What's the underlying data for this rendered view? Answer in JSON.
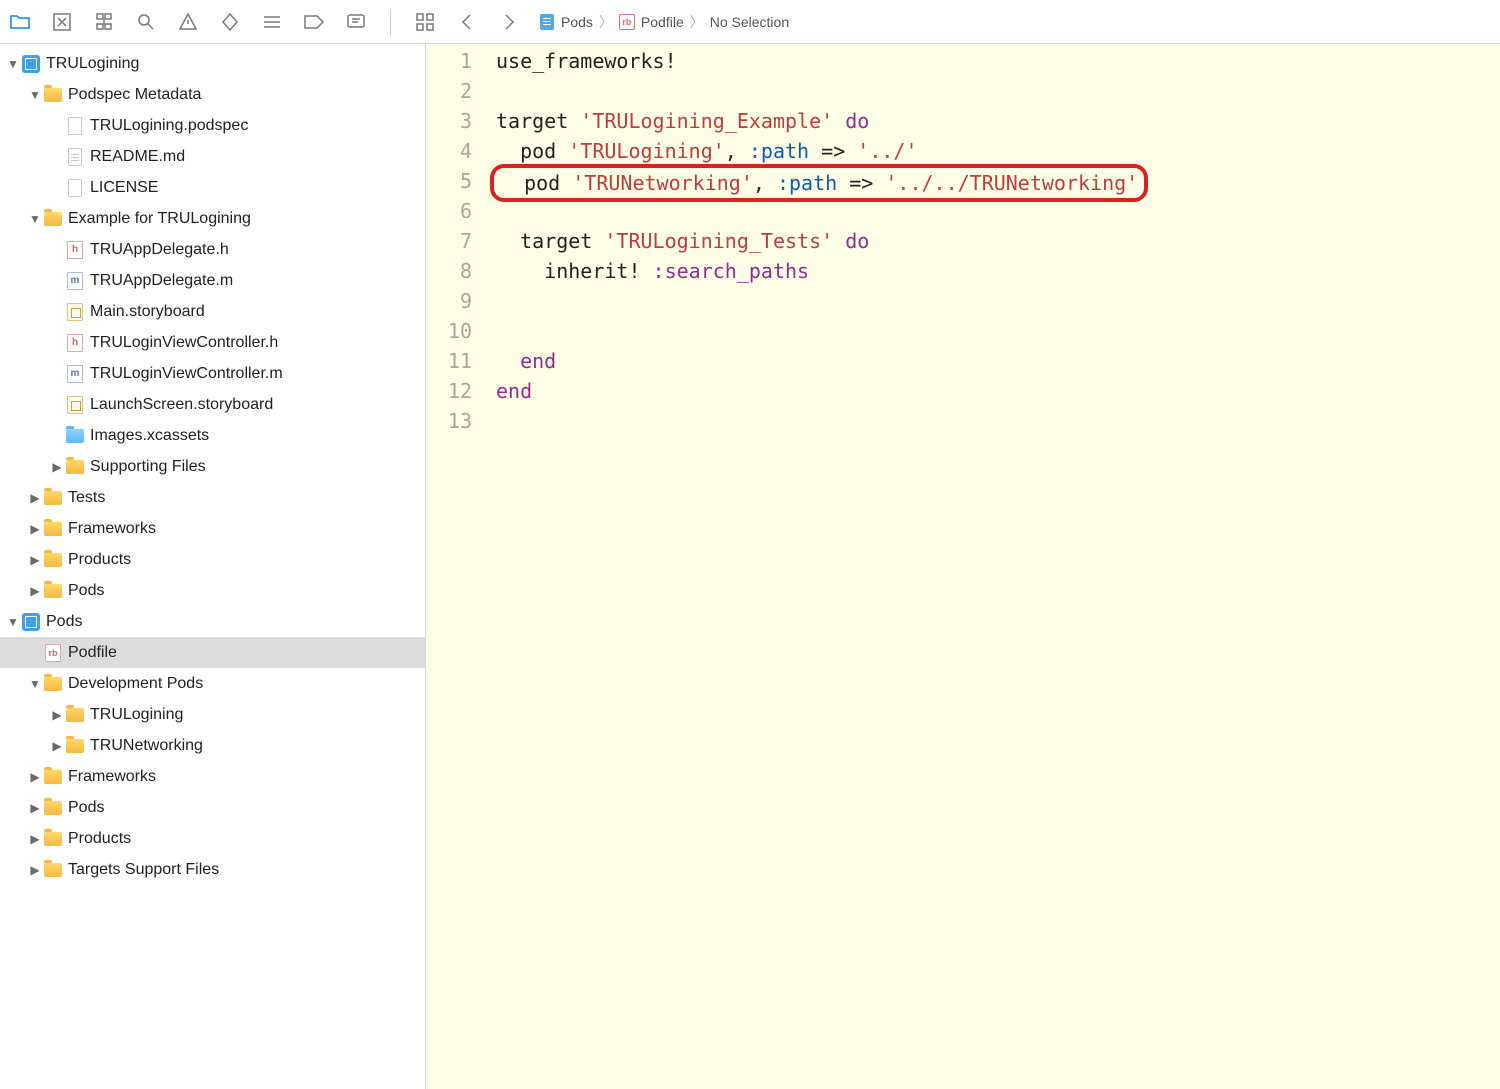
{
  "toolbar": {
    "icons": [
      "folder-icon",
      "schema-icon",
      "hierarchy-icon",
      "search-icon",
      "warning-icon",
      "diamond-icon",
      "list-icon",
      "tag-icon",
      "comment-icon"
    ]
  },
  "breadcrumb": {
    "items": [
      "Pods",
      "Podfile",
      "No Selection"
    ]
  },
  "tree": [
    {
      "label": "TRULogining",
      "depth": 0,
      "icon": "proj",
      "disc": "down"
    },
    {
      "label": "Podspec Metadata",
      "depth": 1,
      "icon": "folder",
      "disc": "down"
    },
    {
      "label": "TRULogining.podspec",
      "depth": 2,
      "icon": "plain",
      "disc": ""
    },
    {
      "label": "README.md",
      "depth": 2,
      "icon": "lines",
      "disc": ""
    },
    {
      "label": "LICENSE",
      "depth": 2,
      "icon": "plain",
      "disc": ""
    },
    {
      "label": "Example for TRULogining",
      "depth": 1,
      "icon": "folder",
      "disc": "down"
    },
    {
      "label": "TRUAppDelegate.h",
      "depth": 2,
      "icon": "h",
      "disc": ""
    },
    {
      "label": "TRUAppDelegate.m",
      "depth": 2,
      "icon": "m",
      "disc": ""
    },
    {
      "label": "Main.storyboard",
      "depth": 2,
      "icon": "story",
      "disc": ""
    },
    {
      "label": "TRULoginViewController.h",
      "depth": 2,
      "icon": "h",
      "disc": ""
    },
    {
      "label": "TRULoginViewController.m",
      "depth": 2,
      "icon": "m",
      "disc": ""
    },
    {
      "label": "LaunchScreen.storyboard",
      "depth": 2,
      "icon": "story",
      "disc": ""
    },
    {
      "label": "Images.xcassets",
      "depth": 2,
      "icon": "folderblue",
      "disc": ""
    },
    {
      "label": "Supporting Files",
      "depth": 2,
      "icon": "folder",
      "disc": "right"
    },
    {
      "label": "Tests",
      "depth": 1,
      "icon": "folder",
      "disc": "right"
    },
    {
      "label": "Frameworks",
      "depth": 1,
      "icon": "folder",
      "disc": "right"
    },
    {
      "label": "Products",
      "depth": 1,
      "icon": "folder",
      "disc": "right"
    },
    {
      "label": "Pods",
      "depth": 1,
      "icon": "folder",
      "disc": "right"
    },
    {
      "label": "Pods",
      "depth": 0,
      "icon": "proj",
      "disc": "down"
    },
    {
      "label": "Podfile",
      "depth": 1,
      "icon": "rb",
      "disc": "",
      "selected": true
    },
    {
      "label": "Development Pods",
      "depth": 1,
      "icon": "folder",
      "disc": "down"
    },
    {
      "label": "TRULogining",
      "depth": 2,
      "icon": "folder",
      "disc": "right"
    },
    {
      "label": "TRUNetworking",
      "depth": 2,
      "icon": "folder",
      "disc": "right"
    },
    {
      "label": "Frameworks",
      "depth": 1,
      "icon": "folder",
      "disc": "right"
    },
    {
      "label": "Pods",
      "depth": 1,
      "icon": "folder",
      "disc": "right"
    },
    {
      "label": "Products",
      "depth": 1,
      "icon": "folder",
      "disc": "right"
    },
    {
      "label": "Targets Support Files",
      "depth": 1,
      "icon": "folder",
      "disc": "right"
    }
  ],
  "code": {
    "lines": [
      [
        {
          "t": "use_frameworks!",
          "c": "txt"
        }
      ],
      [],
      [
        {
          "t": "target ",
          "c": "txt"
        },
        {
          "t": "'TRULogining_Example'",
          "c": "str"
        },
        {
          "t": " ",
          "c": "txt"
        },
        {
          "t": "do",
          "c": "kw"
        }
      ],
      [
        {
          "t": "  pod ",
          "c": "txt"
        },
        {
          "t": "'TRULogining'",
          "c": "str"
        },
        {
          "t": ", ",
          "c": "txt"
        },
        {
          "t": ":path",
          "c": "param"
        },
        {
          "t": " => ",
          "c": "txt"
        },
        {
          "t": "'../'",
          "c": "str"
        }
      ],
      [
        {
          "t": "  pod ",
          "c": "txt"
        },
        {
          "t": "'TRUNetworking'",
          "c": "str"
        },
        {
          "t": ", ",
          "c": "txt"
        },
        {
          "t": ":path",
          "c": "param"
        },
        {
          "t": " => ",
          "c": "txt"
        },
        {
          "t": "'../../TRUNetworking'",
          "c": "str"
        }
      ],
      [],
      [
        {
          "t": "  target ",
          "c": "txt"
        },
        {
          "t": "'TRULogining_Tests'",
          "c": "str"
        },
        {
          "t": " ",
          "c": "txt"
        },
        {
          "t": "do",
          "c": "kw"
        }
      ],
      [
        {
          "t": "    inherit! ",
          "c": "txt"
        },
        {
          "t": ":search_paths",
          "c": "sym"
        }
      ],
      [],
      [],
      [
        {
          "t": "  ",
          "c": "txt"
        },
        {
          "t": "end",
          "c": "kw"
        }
      ],
      [
        {
          "t": "end",
          "c": "kw"
        }
      ],
      []
    ],
    "highlight_line": 5,
    "current_line": 13
  }
}
